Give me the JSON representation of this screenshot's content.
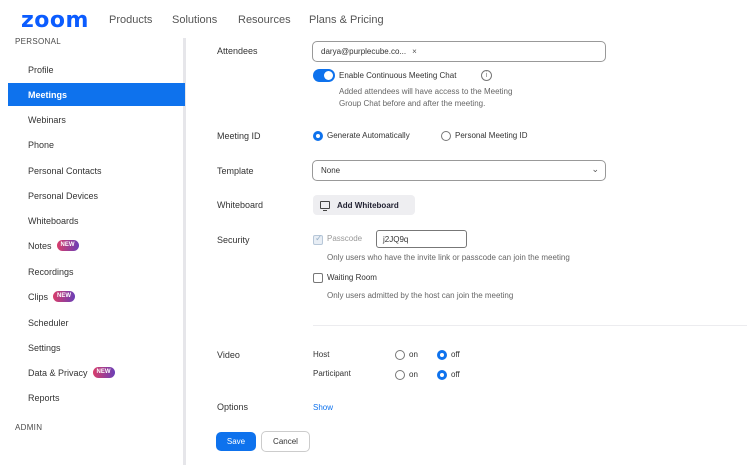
{
  "nav": {
    "logo": "zoom",
    "links": [
      "Products",
      "Solutions",
      "Resources",
      "Plans & Pricing"
    ]
  },
  "sidebar": {
    "personal_label": "PERSONAL",
    "items": [
      {
        "label": "Profile"
      },
      {
        "label": "Meetings",
        "active": true
      },
      {
        "label": "Webinars"
      },
      {
        "label": "Phone"
      },
      {
        "label": "Personal Contacts"
      },
      {
        "label": "Personal Devices"
      },
      {
        "label": "Whiteboards"
      },
      {
        "label": "Notes",
        "badge": "NEW"
      },
      {
        "label": "Recordings"
      },
      {
        "label": "Clips",
        "badge": "NEW"
      },
      {
        "label": "Scheduler"
      },
      {
        "label": "Settings"
      },
      {
        "label": "Data & Privacy",
        "badge": "NEW"
      },
      {
        "label": "Reports"
      }
    ],
    "admin_label": "ADMIN"
  },
  "form": {
    "attendees": {
      "label": "Attendees",
      "chip": "darya@purplecube.co...",
      "chip_remove": "×"
    },
    "continuous_chat": {
      "label": "Enable Continuous Meeting Chat",
      "enabled": true,
      "info_icon": "i",
      "help_line1": "Added attendees will have access to the Meeting",
      "help_line2": "Group Chat before and after the meeting."
    },
    "meeting_id": {
      "label": "Meeting ID",
      "option_auto": "Generate Automatically",
      "option_personal": "Personal Meeting ID",
      "selected": "Generate Automatically"
    },
    "template": {
      "label": "Template",
      "value": "None",
      "chevron": "⌄"
    },
    "whiteboard": {
      "label": "Whiteboard",
      "button": "Add Whiteboard"
    },
    "security": {
      "label": "Security",
      "passcode_label": "Passcode",
      "passcode_value": "j2JQ9q",
      "passcode_help": "Only users who have the invite link or passcode can join the meeting",
      "waiting_room_label": "Waiting Room",
      "waiting_room_help": "Only users admitted by the host can join the meeting"
    },
    "video": {
      "label": "Video",
      "host_label": "Host",
      "participant_label": "Participant",
      "on": "on",
      "off": "off",
      "host_value": "off",
      "participant_value": "off"
    },
    "options": {
      "label": "Options",
      "show_link": "Show"
    }
  },
  "actions": {
    "save": "Save",
    "cancel": "Cancel"
  },
  "colors": {
    "brand": "#0b5cff",
    "accent": "#0e72ed"
  }
}
